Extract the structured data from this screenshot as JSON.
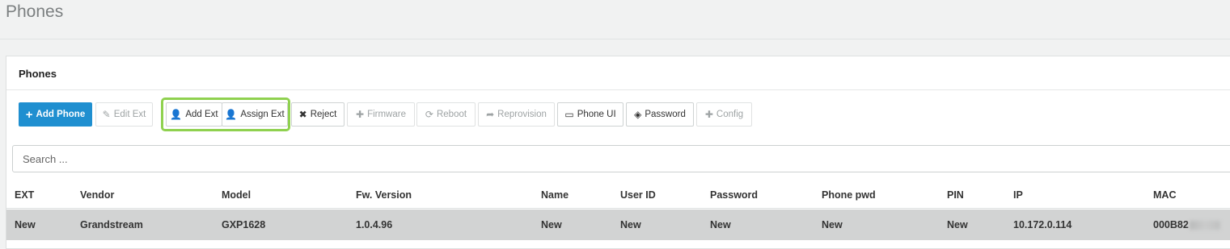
{
  "page": {
    "title": "Phones"
  },
  "panel": {
    "title": "Phones"
  },
  "toolbar": {
    "add_phone": "Add Phone",
    "edit_ext": "Edit Ext",
    "add_ext": "Add Ext",
    "assign_ext": "Assign Ext",
    "reject": "Reject",
    "firmware": "Firmware",
    "reboot": "Reboot",
    "reprovision": "Reprovision",
    "phone_ui": "Phone UI",
    "password": "Password",
    "config": "Config"
  },
  "search": {
    "placeholder": "Search ..."
  },
  "table": {
    "columns": [
      "EXT",
      "Vendor",
      "Model",
      "Fw. Version",
      "Name",
      "User ID",
      "Password",
      "Phone pwd",
      "PIN",
      "IP",
      "MAC"
    ],
    "rows": [
      {
        "ext": "New",
        "vendor": "Grandstream",
        "model": "GXP1628",
        "fw_version": "1.0.4.96",
        "name": "New",
        "user_id": "New",
        "password": "New",
        "phone_pwd": "New",
        "pin": "New",
        "ip": "10.172.0.114",
        "mac": "000B82"
      }
    ]
  },
  "colors": {
    "primary": "#1f8fd0",
    "highlight": "#8fd14f",
    "row_bg": "#d2d3d3"
  }
}
